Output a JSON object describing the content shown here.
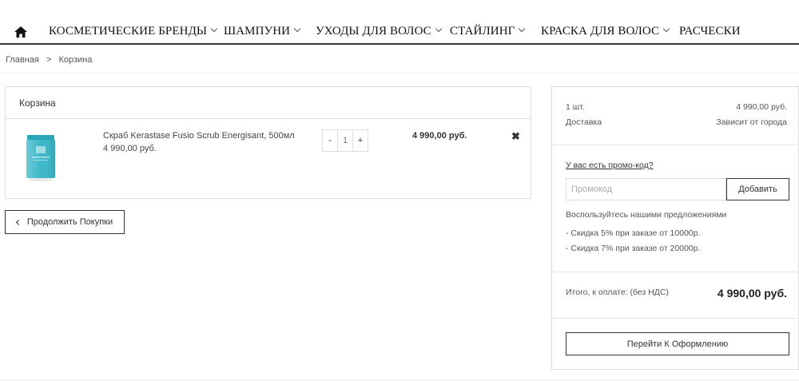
{
  "nav": {
    "items": [
      {
        "label": "КОСМЕТИЧЕСКИЕ БРЕНДЫ",
        "has_dropdown": true
      },
      {
        "label": "ШАМПУНИ",
        "has_dropdown": true
      },
      {
        "label": "УХОДЫ ДЛЯ ВОЛОС",
        "has_dropdown": true
      },
      {
        "label": "СТАЙЛИНГ",
        "has_dropdown": true
      },
      {
        "label": "КРАСКА ДЛЯ ВОЛОС",
        "has_dropdown": true
      },
      {
        "label": "РАСЧЕСКИ",
        "has_dropdown": false
      }
    ],
    "home_icon": "home-icon"
  },
  "breadcrumb": {
    "items": [
      "Главная",
      "Корзина"
    ],
    "separator": ">"
  },
  "cart": {
    "title": "Корзина",
    "product": {
      "name": "Скраб Kerastase Fusio Scrub Energisant, 500мл",
      "price": "4 990,00 руб.",
      "quantity": "1",
      "decrement": "-",
      "increment": "+",
      "line_total": "4 990,00 руб.",
      "remove_icon": "close-icon"
    },
    "continue_label": "Продолжить Покупки"
  },
  "summary": {
    "count_label": "1 шт.",
    "count_value": "4 990,00 руб.",
    "delivery_label": "Доставка",
    "delivery_value": "Зависит от города",
    "promo_link": "У вас есть промо-код?",
    "promo_placeholder": "Промокод",
    "promo_button": "Добавить",
    "offers_title": "Воспользуйтесь нашими предложениями",
    "offers": [
      "- Скидка 5% при заказе от 10000р.",
      "- Скидка 7% при заказе от 20000р."
    ],
    "total_label": "Итого, к оплате: (без НДС)",
    "total_value": "4 990,00 руб.",
    "checkout_label": "Перейти К Оформлению"
  },
  "colors": {
    "text": "#333333",
    "border": "#dddddd",
    "product_teal": "#3cb8c8"
  }
}
